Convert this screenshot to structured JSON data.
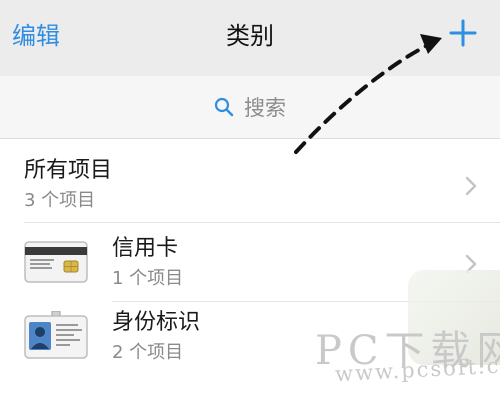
{
  "navbar": {
    "edit_label": "编辑",
    "title": "类别",
    "add_label": "+"
  },
  "search": {
    "placeholder": "搜索"
  },
  "list": [
    {
      "title": "所有项目",
      "subtitle": "3 个项目"
    },
    {
      "title": "信用卡",
      "subtitle": "1 个项目",
      "icon": "credit-card-icon"
    },
    {
      "title": "身份标识",
      "subtitle": "2 个项目",
      "icon": "id-card-icon"
    }
  ],
  "watermark": {
    "title": "PC下载网",
    "url": "www.pcsoft.com.cn"
  },
  "colors": {
    "accent": "#2f8de4",
    "nav_bg": "#ececec",
    "search_bg": "#f6f6f6"
  }
}
